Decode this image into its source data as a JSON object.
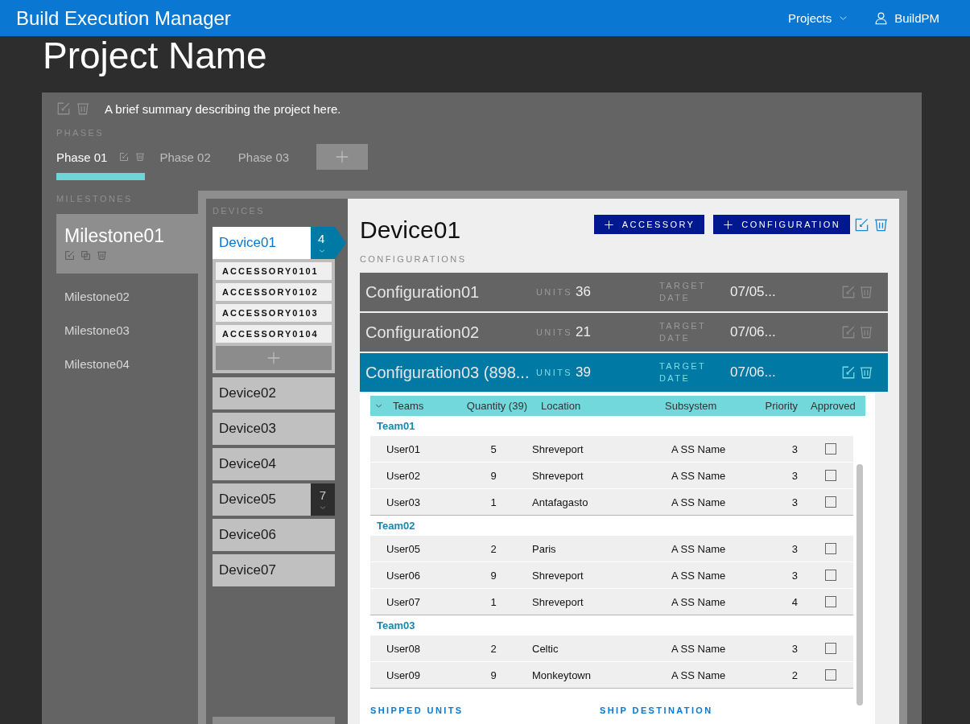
{
  "app_bar": {
    "title": "Build Execution Manager",
    "menu": "Projects",
    "user": "BuildPM"
  },
  "project": {
    "title": "Project Name",
    "summary": "A brief summary describing the project here."
  },
  "phases": {
    "label": "PHASES",
    "items": [
      {
        "label": "Phase 01",
        "selected": true
      },
      {
        "label": "Phase 02",
        "selected": false
      },
      {
        "label": "Phase 03",
        "selected": false
      }
    ]
  },
  "milestones": {
    "label": "MILESTONES",
    "items": [
      {
        "label": "Milestone01",
        "selected": true
      },
      {
        "label": "Milestone02",
        "selected": false
      },
      {
        "label": "Milestone03",
        "selected": false
      },
      {
        "label": "Milestone04",
        "selected": false
      }
    ]
  },
  "devices": {
    "label": "DEVICES",
    "items": [
      {
        "label": "Device01",
        "selected": true,
        "count": "4",
        "accessories": [
          "ACCESSORY0101",
          "ACCESSORY0102",
          "ACCESSORY0103",
          "ACCESSORY0104"
        ]
      },
      {
        "label": "Device02",
        "selected": false
      },
      {
        "label": "Device03",
        "selected": false
      },
      {
        "label": "Device04",
        "selected": false
      },
      {
        "label": "Device05",
        "selected": false,
        "count": "7"
      },
      {
        "label": "Device06",
        "selected": false
      },
      {
        "label": "Device07",
        "selected": false
      }
    ]
  },
  "device_detail": {
    "title": "Device01",
    "buttons": [
      "ACCESSORY",
      "CONFIGURATION"
    ],
    "configurations_label": "CONFIGURATIONS",
    "configurations": [
      {
        "name": "Configuration01",
        "units_label": "UNITS",
        "units": "36",
        "date_label": "TARGET DATE",
        "date": "07/05...",
        "selected": false
      },
      {
        "name": "Configuration02",
        "units_label": "UNITS",
        "units": "21",
        "date_label": "TARGET DATE",
        "date": "07/06...",
        "selected": false
      },
      {
        "name": "Configuration03 (898...",
        "units_label": "UNITS",
        "units": "39",
        "date_label": "TARGET DATE",
        "date": "07/06...",
        "selected": true
      }
    ]
  },
  "teams_table": {
    "expanded": true,
    "columns": [
      "Teams",
      "Quantity (39)",
      "Location",
      "Subsystem",
      "Priority",
      "Approved"
    ],
    "groups": [
      {
        "name": "Team01",
        "rows": [
          {
            "cells": [
              "User01",
              "5",
              "Shreveport",
              "A SS Name",
              "3"
            ],
            "approved": false
          },
          {
            "cells": [
              "User02",
              "9",
              "Shreveport",
              "A SS Name",
              "3"
            ],
            "approved": false
          },
          {
            "cells": [
              "User03",
              "1",
              "Antafagasto",
              "A SS Name",
              "3"
            ],
            "approved": false
          }
        ]
      },
      {
        "name": "Team02",
        "rows": [
          {
            "cells": [
              "User05",
              "2",
              "Paris",
              "A SS Name",
              "3"
            ],
            "approved": false
          },
          {
            "cells": [
              "User06",
              "9",
              "Shreveport",
              "A SS Name",
              "3"
            ],
            "approved": false
          },
          {
            "cells": [
              "User07",
              "1",
              "Shreveport",
              "A SS Name",
              "4"
            ],
            "approved": false
          }
        ]
      },
      {
        "name": "Team03",
        "rows": [
          {
            "cells": [
              "User08",
              "2",
              "Celtic",
              "A SS Name",
              "3"
            ],
            "approved": false
          },
          {
            "cells": [
              "User09",
              "9",
              "Monkeytown",
              "A SS Name",
              "2"
            ],
            "approved": false
          }
        ]
      }
    ]
  },
  "sections": [
    "SHIPPED UNITS",
    "SHIP DESTINATION"
  ]
}
